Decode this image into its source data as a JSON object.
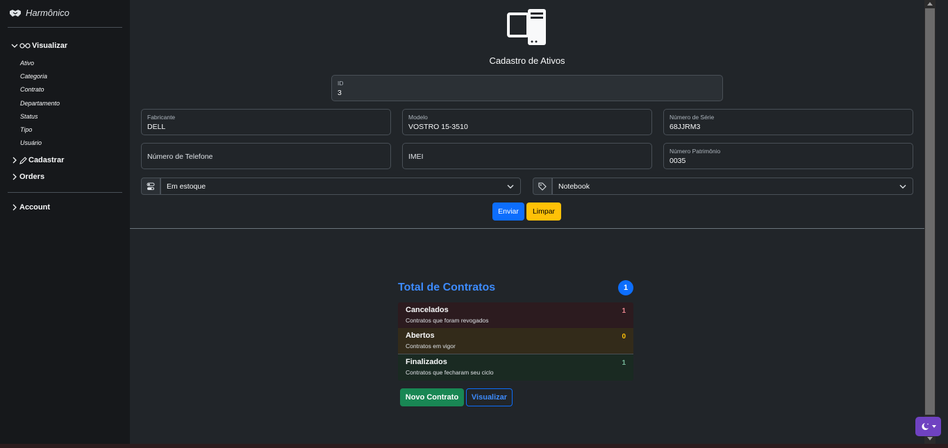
{
  "sidebar": {
    "brand": "Harmônico",
    "groups": {
      "visualizar": "Visualizar",
      "cadastrar": "Cadastrar",
      "orders": "Orders",
      "account": "Account"
    },
    "visualizar_items": [
      "Ativo",
      "Categoria",
      "Contrato",
      "Departamento",
      "Status",
      "Tipo",
      "Usuário"
    ]
  },
  "form": {
    "title": "Cadastro de Ativos",
    "id": {
      "label": "ID",
      "value": "3"
    },
    "fabricante": {
      "label": "Fabricante",
      "value": "DELL"
    },
    "modelo": {
      "label": "Modelo",
      "value": "VOSTRO 15-3510"
    },
    "numero_serie": {
      "label": "Número de Série",
      "value": "68JJRM3"
    },
    "numero_telefone": {
      "placeholder": "Número de Telefone"
    },
    "imei": {
      "placeholder": "IMEI"
    },
    "patrimonio": {
      "label": "Número Patrimônio",
      "value": "0035"
    },
    "status_select": "Em estoque",
    "categoria_select": "Notebook",
    "submit": "Enviar",
    "clear": "Limpar"
  },
  "contracts": {
    "title": "Total de Contratos",
    "total": "1",
    "items": [
      {
        "title": "Cancelados",
        "desc": "Contratos que foram revogados",
        "count": "1",
        "color": "#ea868f"
      },
      {
        "title": "Abertos",
        "desc": "Contratos em vigor",
        "count": "0",
        "color": "#ffc107"
      },
      {
        "title": "Finalizados",
        "desc": "Contratos que fecharam seu ciclo",
        "count": "1",
        "color": "#75b798"
      }
    ],
    "new_button": "Novo Contrato",
    "view_button": "Visualizar"
  },
  "colors": {
    "primary": "#0d6efd",
    "warning": "#ffc107",
    "success": "#198754",
    "theme_toggle": "#6f42c1"
  }
}
